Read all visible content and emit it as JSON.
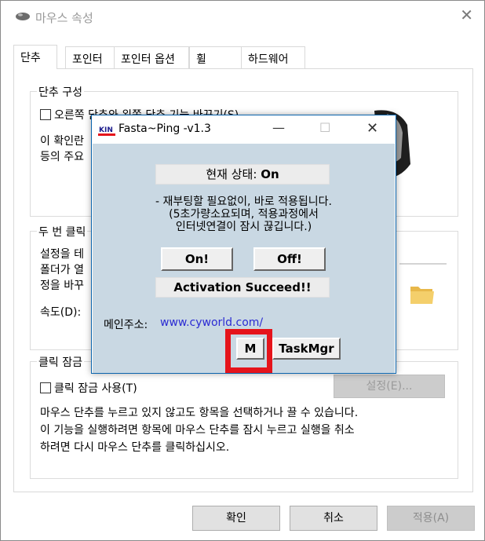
{
  "main_window": {
    "title": "마우스 속성",
    "tabs": [
      "단추",
      "포인터",
      "포인터 옵션",
      "휠",
      "하드웨어"
    ],
    "button_config": {
      "group_title": "단추 구성",
      "swap_checkbox_label": "오른쪽 단추와 왼쪽 단추 기능 바꾸기(S)",
      "desc_line1": "이 확인란",
      "desc_line2": "등의 주요"
    },
    "double_click": {
      "group_title": "두 번 클릭",
      "desc_line1": "설정을 테",
      "desc_line2": "폴더가 열",
      "desc_line3": "정을 바꾸",
      "speed_label": "속도(D):"
    },
    "click_lock": {
      "group_title": "클릭 잠금",
      "checkbox_label": "클릭 잠금 사용(T)",
      "settings_button": "설정(E)...",
      "desc_line1": "마우스 단추를 누르고 있지 않고도 항목을 선택하거나 끌 수 있습니다.",
      "desc_line2": "이 기능을 실행하려면 항목에 마우스 단추를 잠시 누르고 실행을 취소",
      "desc_line3": "하려면 다시 마우스 단추를 클릭하십시오."
    },
    "footer": {
      "ok": "확인",
      "cancel": "취소",
      "apply": "적용(A)"
    }
  },
  "popup": {
    "logo_text": "KIN",
    "title": "Fasta~Ping -v1.3",
    "status_label": "현재 상태:",
    "status_value": "On",
    "info_line1": "- 재부팅할 필요없이, 바로 적용됩니다.",
    "info_line2": "(5초가량소요되며, 적용과정에서",
    "info_line3": "인터넷연결이 잠시 끊깁니다.)",
    "on_button": "On!",
    "off_button": "Off!",
    "activation_message": "Activation Succeed!!",
    "homepage_label": "메인주소:",
    "homepage_link": "www.cyworld.com/",
    "m_button": "M",
    "taskmgr_button": "TaskMgr"
  },
  "colors": {
    "highlight": "#e5141b",
    "popup_body": "#c9d8e3",
    "link": "#2b2bd3"
  }
}
